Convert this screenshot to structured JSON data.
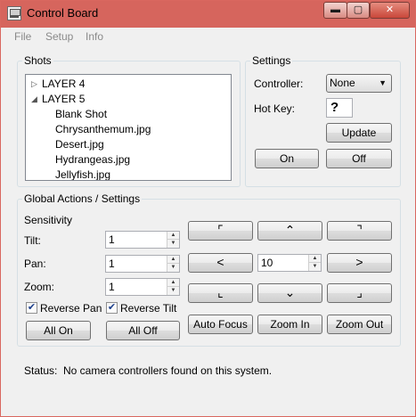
{
  "window": {
    "title": "Control Board",
    "controls": {
      "minimize": "▬",
      "maximize": "▢",
      "close": "✕"
    }
  },
  "menu": {
    "items": [
      "File",
      "Setup",
      "Info"
    ]
  },
  "shots": {
    "label": "Shots",
    "items": [
      {
        "text": "LAYER 4",
        "expanded": false,
        "arrow": "▷"
      },
      {
        "text": "LAYER 5",
        "expanded": true,
        "arrow": "◢"
      },
      {
        "text": "Blank Shot"
      },
      {
        "text": "Chrysanthemum.jpg"
      },
      {
        "text": "Desert.jpg"
      },
      {
        "text": "Hydrangeas.jpg"
      },
      {
        "text": "Jellyfish.jpg"
      }
    ],
    "scroll_up": "▲",
    "scroll_down": "▼"
  },
  "settings": {
    "label": "Settings",
    "controller_label": "Controller:",
    "controller_value": "None",
    "hotkey_label": "Hot Key:",
    "hotkey_value": "?",
    "update_label": "Update",
    "on_label": "On",
    "off_label": "Off",
    "caret": "▼"
  },
  "global": {
    "label": "Global Actions / Settings",
    "sensitivity_label": "Sensitivity",
    "tilt_label": "Tilt:",
    "tilt_value": "1",
    "pan_label": "Pan:",
    "pan_value": "1",
    "zoom_label": "Zoom:",
    "zoom_value": "1",
    "reverse_pan_label": "Reverse Pan",
    "reverse_pan_checked": true,
    "reverse_tilt_label": "Reverse Tilt",
    "reverse_tilt_checked": true,
    "all_on_label": "All On",
    "all_off_label": "All Off",
    "spin_up": "▲",
    "spin_down": "▼",
    "check_mark": "✔",
    "dpad": {
      "up_left": "⌜",
      "up": "⌃",
      "up_right": "⌝",
      "left": "<",
      "right": ">",
      "down_left": "⌞",
      "down": "⌄",
      "down_right": "⌟",
      "speed_value": "10"
    },
    "auto_focus_label": "Auto Focus",
    "zoom_in_label": "Zoom In",
    "zoom_out_label": "Zoom Out"
  },
  "status": {
    "label": "Status:",
    "message": "No camera controllers found on this system."
  }
}
